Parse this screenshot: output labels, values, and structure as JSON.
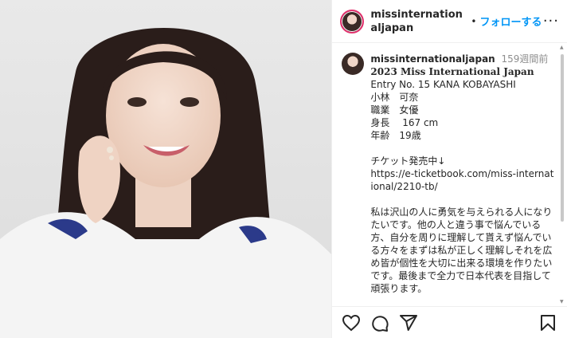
{
  "header": {
    "username": "missinternationaljapan",
    "follow_label": "フォローする",
    "dot": "•",
    "more": "···"
  },
  "caption": {
    "username": "missinternationaljapan",
    "time": "159週間前",
    "title": "2023 Miss International Japan",
    "lines": [
      "Entry No. 15 KANA KOBAYASHI",
      "小林　可奈",
      "職業　女優",
      "身長　 167 cm",
      "年齢　19歳"
    ],
    "ticket_label": "チケット発売中↓",
    "ticket_link": "https://e-ticketbook.com/miss-international/2210-tb/",
    "message": "私は沢山の人に勇気を与えられる人になりたいです。他の人と違う事で悩んでいる方、自分を周りに理解して貰えず悩んでいる方々をまずは私が正しく理解しそれを広め皆が個性を大切に出来る環境を作りたいです。最後まで全力で日本代表を目指して頑張ります。"
  },
  "icons": [
    "heart-icon",
    "comment-icon",
    "share-icon",
    "bookmark-icon"
  ]
}
